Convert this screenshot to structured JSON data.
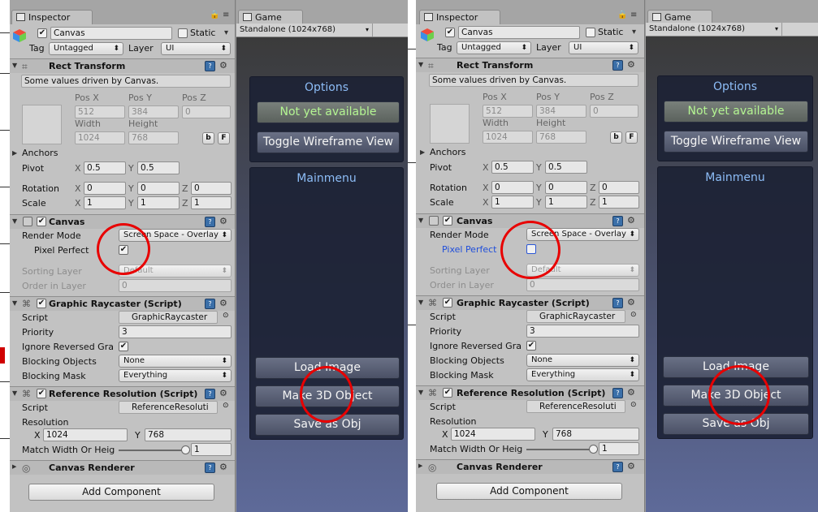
{
  "panels": [
    {
      "inspector_tab": "Inspector",
      "game_tab": "Game",
      "game_resolution": "Standalone (1024x768)",
      "object_name": "Canvas",
      "static_label": "Static",
      "tag_label": "Tag",
      "tag_value": "Untagged",
      "layer_label": "Layer",
      "layer_value": "UI",
      "rect_transform": {
        "title": "Rect Transform",
        "note": "Some values driven by Canvas.",
        "pos_x_label": "Pos X",
        "pos_y_label": "Pos Y",
        "pos_z_label": "Pos Z",
        "pos_x": "512",
        "pos_y": "384",
        "pos_z": "0",
        "width_label": "Width",
        "height_label": "Height",
        "width": "1024",
        "height": "768",
        "b_label": "b",
        "r_label": "F",
        "anchors_label": "Anchors",
        "pivot_label": "Pivot",
        "pivot_x": "0.5",
        "pivot_y": "0.5",
        "rotation_label": "Rotation",
        "rot_x": "0",
        "rot_y": "0",
        "rot_z": "0",
        "scale_label": "Scale",
        "scale_x": "1",
        "scale_y": "1",
        "scale_z": "1",
        "x": "X",
        "y": "Y",
        "z": "Z"
      },
      "canvas": {
        "title": "Canvas",
        "render_mode_label": "Render Mode",
        "render_mode": "Screen Space - Overlay",
        "pixel_perfect_label": "Pixel Perfect",
        "pixel_perfect_mark": "✔",
        "sorting_layer_label": "Sorting Layer",
        "sorting_layer": "Default",
        "order_label": "Order in Layer",
        "order": "0"
      },
      "raycaster": {
        "title": "Graphic Raycaster (Script)",
        "script_label": "Script",
        "script": "GraphicRaycaster",
        "priority_label": "Priority",
        "priority": "3",
        "ignore_label": "Ignore Reversed Gra",
        "ignore_mark": "✔",
        "blocking_objects_label": "Blocking Objects",
        "blocking_objects": "None",
        "blocking_mask_label": "Blocking Mask",
        "blocking_mask": "Everything"
      },
      "refres": {
        "title": "Reference Resolution (Script)",
        "script_label": "Script",
        "script": "ReferenceResoluti",
        "resolution_label": "Resolution",
        "x_label": "X",
        "x": "1024",
        "y_label": "Y",
        "y": "768",
        "match_label": "Match Width Or Heig",
        "match": "1",
        "match_fraction": 1
      },
      "canvas_renderer": {
        "title": "Canvas Renderer"
      },
      "add_component": "Add Component",
      "options_title": "Options",
      "not_available": "Not yet available",
      "toggle_wireframe": "Toggle Wireframe View",
      "mainmenu_title": "Mainmenu",
      "load_image": "Load Image",
      "make_3d": "Make 3D Object",
      "save_obj": "Save as Obj"
    },
    {
      "inspector_tab": "Inspector",
      "game_tab": "Game",
      "game_resolution": "Standalone (1024x768)",
      "object_name": "Canvas",
      "static_label": "Static",
      "tag_label": "Tag",
      "tag_value": "Untagged",
      "layer_label": "Layer",
      "layer_value": "UI",
      "rect_transform": {
        "title": "Rect Transform",
        "note": "Some values driven by Canvas.",
        "pos_x_label": "Pos X",
        "pos_y_label": "Pos Y",
        "pos_z_label": "Pos Z",
        "pos_x": "512",
        "pos_y": "384",
        "pos_z": "0",
        "width_label": "Width",
        "height_label": "Height",
        "width": "1024",
        "height": "768",
        "b_label": "b",
        "r_label": "F",
        "anchors_label": "Anchors",
        "pivot_label": "Pivot",
        "pivot_x": "0.5",
        "pivot_y": "0.5",
        "rotation_label": "Rotation",
        "rot_x": "0",
        "rot_y": "0",
        "rot_z": "0",
        "scale_label": "Scale",
        "scale_x": "1",
        "scale_y": "1",
        "scale_z": "1",
        "x": "X",
        "y": "Y",
        "z": "Z"
      },
      "canvas": {
        "title": "Canvas",
        "render_mode_label": "Render Mode",
        "render_mode": "Screen Space - Overlay",
        "pixel_perfect_label": "Pixel Perfect",
        "pixel_perfect_mark": "",
        "sorting_layer_label": "Sorting Layer",
        "sorting_layer": "Default",
        "order_label": "Order in Layer",
        "order": "0"
      },
      "raycaster": {
        "title": "Graphic Raycaster (Script)",
        "script_label": "Script",
        "script": "GraphicRaycaster",
        "priority_label": "Priority",
        "priority": "3",
        "ignore_label": "Ignore Reversed Gra",
        "ignore_mark": "✔",
        "blocking_objects_label": "Blocking Objects",
        "blocking_objects": "None",
        "blocking_mask_label": "Blocking Mask",
        "blocking_mask": "Everything"
      },
      "refres": {
        "title": "Reference Resolution (Script)",
        "script_label": "Script",
        "script": "ReferenceResoluti",
        "resolution_label": "Resolution",
        "x_label": "X",
        "x": "1024",
        "y_label": "Y",
        "y": "768",
        "match_label": "Match Width Or Heig",
        "match": "1",
        "match_fraction": 1
      },
      "canvas_renderer": {
        "title": "Canvas Renderer"
      },
      "add_component": "Add Component",
      "options_title": "Options",
      "not_available": "Not yet available",
      "toggle_wireframe": "Toggle Wireframe View",
      "mainmenu_title": "Mainmenu",
      "load_image": "Load Image",
      "make_3d": "Make 3D Object",
      "save_obj": "Save as Obj"
    }
  ],
  "colors": {
    "annotation_ring": "#e80000",
    "menu_title": "#8dbdf7",
    "disabled_field_label_blue": "#1f4edb",
    "not_available_text": "#b4f592"
  }
}
